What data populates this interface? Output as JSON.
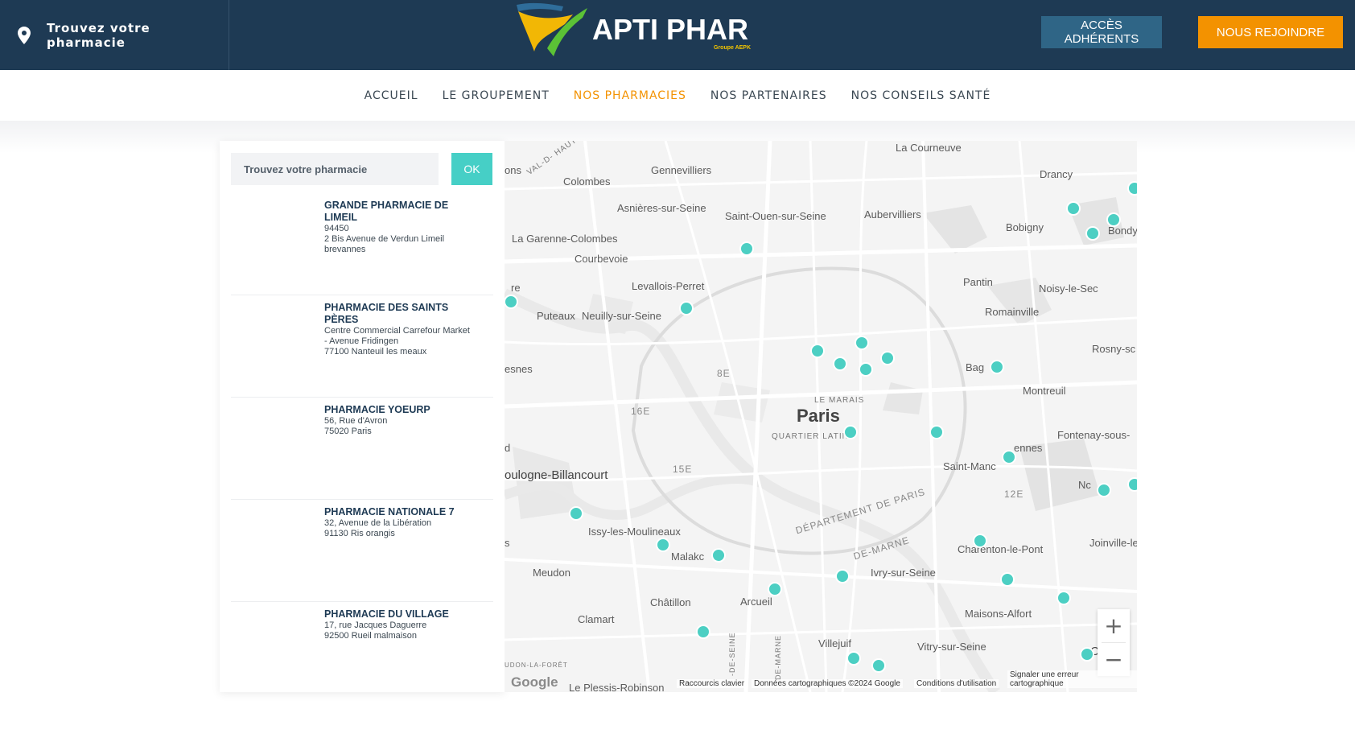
{
  "header": {
    "find_label": "Trouvez votre pharmacie",
    "logo_text": "APTI PHAR",
    "logo_sub": "Groupe AEPK",
    "members_button": "ACCÈS ADHÉRENTS",
    "join_button": "NOUS REJOINDRE"
  },
  "nav": {
    "items": [
      {
        "label": "ACCUEIL"
      },
      {
        "label": "LE GROUPEMENT"
      },
      {
        "label": "NOS PHARMACIES",
        "active": true
      },
      {
        "label": "NOS PARTENAIRES"
      },
      {
        "label": "NOS CONSEILS SANTÉ"
      }
    ]
  },
  "search": {
    "placeholder": "Trouvez votre pharmacie",
    "ok_label": "OK"
  },
  "pharmacies": [
    {
      "name": "GRANDE PHARMACIE DE LIMEIL",
      "lines": [
        "94450",
        "2 Bis Avenue de Verdun Limeil",
        "brevannes"
      ]
    },
    {
      "name": "PHARMACIE DES SAINTS PÈRES",
      "lines": [
        "Centre Commercial Carrefour Market",
        "- Avenue Fridingen",
        "77100 Nanteuil les meaux"
      ]
    },
    {
      "name": "PHARMACIE YOEURP",
      "lines": [
        "56, Rue d'Avron",
        "75020 Paris"
      ]
    },
    {
      "name": "PHARMACIE NATIONALE 7",
      "lines": [
        "32, Avenue de la Libération",
        "91130 Ris orangis"
      ]
    },
    {
      "name": "PHARMACIE DU VILLAGE",
      "lines": [
        "17, rue Jacques Daguerre",
        "92500 Rueil malmaison"
      ]
    }
  ],
  "map": {
    "labels": {
      "la_courneuve": "La Courneuve",
      "drancy": "Drancy",
      "colombes": "Colombes",
      "gennevilliers": "Gennevilliers",
      "asnieres": "Asnières-sur-Seine",
      "saint_ouen": "Saint-Ouen-sur-Seine",
      "aubervilliers": "Aubervilliers",
      "bobigny": "Bobigny",
      "bondy": "Bondy",
      "garenne": "La Garenne-Colombes",
      "courbevoie": "Courbevoie",
      "levallois": "Levallois-Perret",
      "pantin": "Pantin",
      "noisy": "Noisy-le-Sec",
      "romainville": "Romainville",
      "puteaux": "Puteaux",
      "neuilly": "Neuilly-sur-Seine",
      "rosny": "Rosny-sc",
      "esnes": "esnes",
      "arr8": "8E",
      "bag": "Bag",
      "montreuil": "Montreuil",
      "arr16": "16E",
      "marais": "LE MARAIS",
      "paris": "Paris",
      "latin": "QUARTIER LATIN",
      "fontenay": "Fontenay-sous-",
      "vennes": "ennes",
      "saint_mande": "Saint-Manc",
      "arr15": "15E",
      "boulogne": "oulogne-Billancourt",
      "arr12": "12E",
      "nc": "Nc",
      "issy": "Issy-les-Moulineaux",
      "dept_paris": "DÉPARTEMENT DE PARIS",
      "charenton": "Charenton-le-Pont",
      "joinville": "Joinville-le-Pon",
      "malakoff": "Malakc",
      "de_marne": "DE-MARNE",
      "ivry": "Ivry-sur-Seine",
      "meudon": "Meudon",
      "chatillon": "Châtillon",
      "arcueil": "Arcueil",
      "maisons": "Maisons-Alfort",
      "clamart": "Clamart",
      "villejuif": "Villejuif",
      "vitry": "Vitry-sur-Seine",
      "creteil": "Crét",
      "plessis": "Le Plessis-Robinson",
      "val_de_seine": "VAL-D- HAUTS-DE-SE",
      "ons": "ons",
      "re": "re",
      "d": "d",
      "s": "s",
      "foret": "UDON-LA-FORÊT",
      "hauts_de_seine": "-DE-SEINE",
      "val_de_marne": "DE-MARNE"
    },
    "footer": {
      "logo": "Google",
      "shortcuts": "Raccourcis clavier",
      "data": "Données cartographiques ©2024 Google",
      "terms": "Conditions d'utilisation",
      "report": "Signaler une erreur cartographique"
    },
    "zoom_in": "+",
    "zoom_out": "−"
  }
}
